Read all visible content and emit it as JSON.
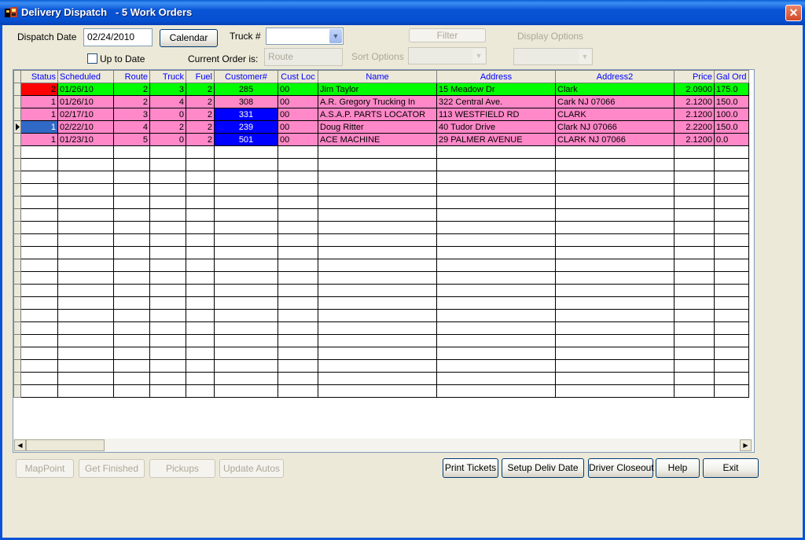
{
  "window": {
    "title": "Delivery Dispatch   - 5 Work Orders",
    "close_glyph": "✕"
  },
  "filters": {
    "dispatch_date_label": "Dispatch Date",
    "dispatch_date_value": "02/24/2010",
    "calendar_button": "Calendar",
    "truck_label": "Truck #",
    "truck_value": "",
    "filter_button": "Filter",
    "display_options_label": "Display Options",
    "up_to_date_label": "Up to Date",
    "current_order_label": "Current Order is:",
    "current_order_value": "Route",
    "sort_options_label": "Sort Options"
  },
  "grid": {
    "columns": [
      "Status",
      "Scheduled",
      "Route",
      "Truck",
      "Fuel",
      "Customer#",
      "Cust Loc",
      "Name",
      "Address",
      "Address2",
      "Price",
      "Gal Ord"
    ],
    "rows": [
      {
        "status": "2",
        "scheduled": "01/26/10",
        "route": "2",
        "truck": "3",
        "fuel": "2",
        "customer": "285",
        "custloc": "00",
        "name": "Jim Taylor",
        "address": "15 Meadow Dr",
        "address2": "Clark",
        "price": "2.0900",
        "gal": "175.0"
      },
      {
        "status": "1",
        "scheduled": "01/26/10",
        "route": "2",
        "truck": "4",
        "fuel": "2",
        "customer": "308",
        "custloc": "00",
        "name": "A.R. Gregory Trucking In",
        "address": "322 Central Ave.",
        "address2": "Cark  NJ  07066",
        "price": "2.1200",
        "gal": "150.0"
      },
      {
        "status": "1",
        "scheduled": "02/17/10",
        "route": "3",
        "truck": "0",
        "fuel": "2",
        "customer": "331",
        "custloc": "00",
        "name": "A.S.A.P. PARTS LOCATOR",
        "address": "113 WESTFIELD RD",
        "address2": "CLARK",
        "price": "2.1200",
        "gal": "100.0"
      },
      {
        "status": "1",
        "scheduled": "02/22/10",
        "route": "4",
        "truck": "2",
        "fuel": "2",
        "customer": "239",
        "custloc": "00",
        "name": "Doug Ritter",
        "address": "40 Tudor Drive",
        "address2": "Clark NJ  07066",
        "price": "2.2200",
        "gal": "150.0"
      },
      {
        "status": "1",
        "scheduled": "01/23/10",
        "route": "5",
        "truck": "0",
        "fuel": "2",
        "customer": "501",
        "custloc": "00",
        "name": "ACE MACHINE",
        "address": "29 PALMER AVENUE",
        "address2": "CLARK  NJ  07066",
        "price": "2.1200",
        "gal": "0.0"
      }
    ]
  },
  "buttons": {
    "mappoint": "MapPoint",
    "get_finished": "Get Finished",
    "pickups": "Pickups",
    "update_autos": "Update Autos",
    "print_tickets": "Print Tickets",
    "setup_deliv_date": "Setup Deliv Date",
    "driver_closeout": "Driver Closeout",
    "help": "Help",
    "exit": "Exit"
  },
  "colors": {
    "row_green": "#00FF00",
    "row_pink": "#FF88C8",
    "status_red": "#FF0000",
    "customer_blue": "#0000FF",
    "header_text": "#0000FF"
  }
}
